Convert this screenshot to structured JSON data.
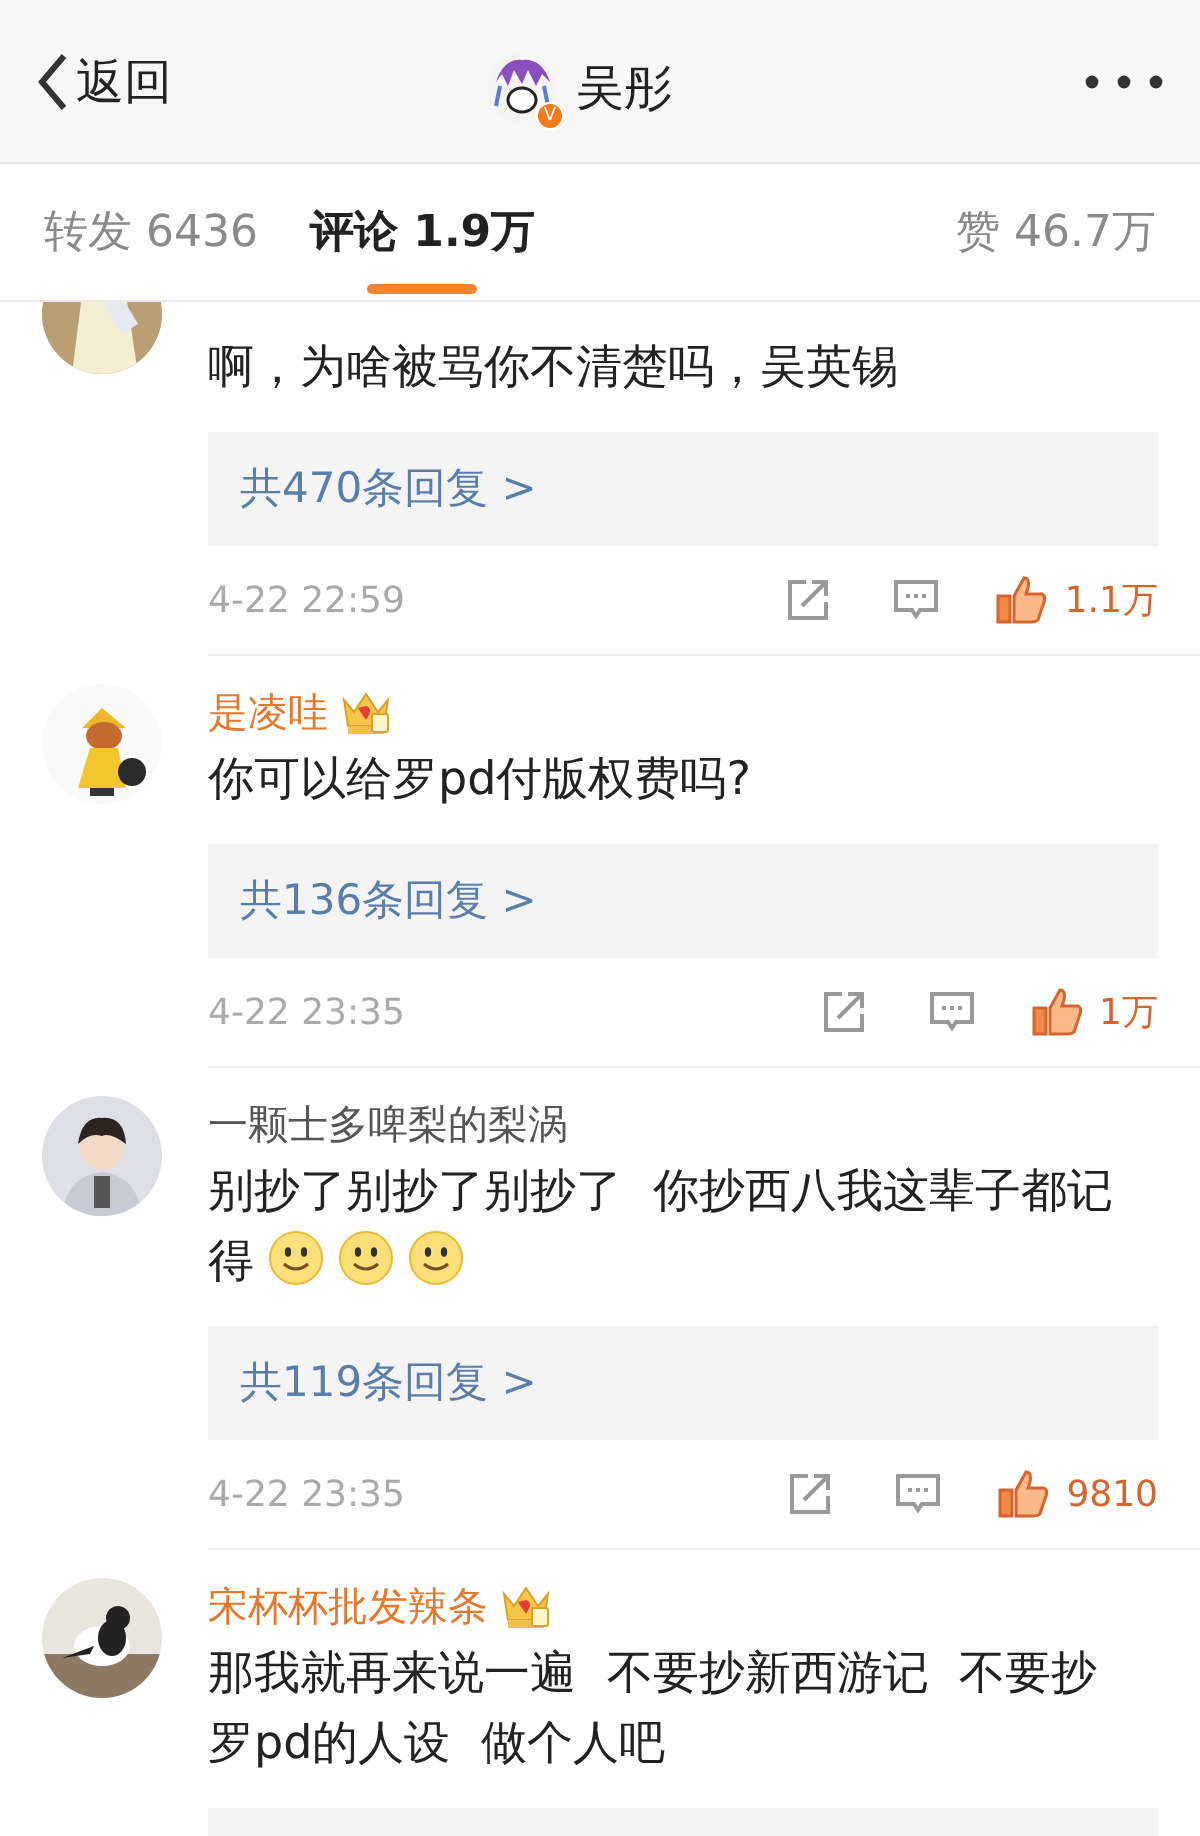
{
  "header": {
    "back_label": "返回",
    "title": "吴彤",
    "verified_mark": "V"
  },
  "tabs": [
    {
      "label": "转发 6436",
      "selected": false
    },
    {
      "label": "评论 1.9万",
      "selected": true
    },
    {
      "label": "赞 46.7万",
      "selected": false
    }
  ],
  "comments": [
    {
      "text": "啊，为啥被骂你不清楚吗，吴英锡",
      "replies": "共470条回复 >",
      "time": "4-22 22:59",
      "likes": "1.1万",
      "liked": true
    },
    {
      "name": "是凌哇",
      "vip": true,
      "text": "你可以给罗pd付版权费吗?",
      "replies": "共136条回复 >",
      "time": "4-22 23:35",
      "likes": "1万",
      "liked": true
    },
    {
      "name": "一颗士多啤梨的梨涡",
      "vip": false,
      "text": "别抄了别抄了别抄了 你抄西八我这辈子都记得",
      "emojis": [
        {
          "kind": "smile"
        },
        {
          "kind": "smile"
        },
        {
          "kind": "smile"
        }
      ],
      "replies": "共119条回复 >",
      "time": "4-22 23:35",
      "likes": "9810",
      "liked": true
    },
    {
      "name": "宋杯杯批发辣条",
      "vip": true,
      "text": "那我就再来说一遍 不要抄新西游记 不要抄罗pd的人设 做个人吧"
    }
  ]
}
